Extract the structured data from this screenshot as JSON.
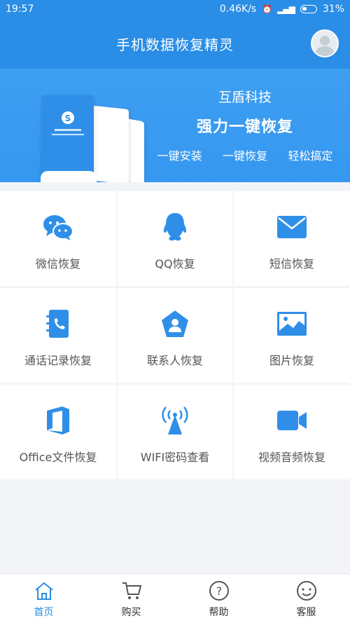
{
  "status": {
    "time": "19:57",
    "network_speed": "0.46K/s",
    "battery": "31%"
  },
  "header": {
    "title": "手机数据恢复精灵"
  },
  "banner": {
    "company": "互盾科技",
    "slogan": "强力一键恢复",
    "features": [
      "一键安装",
      "一键恢复",
      "轻松搞定"
    ]
  },
  "grid": {
    "items": [
      {
        "label": "微信恢复",
        "icon": "wechat-icon"
      },
      {
        "label": "QQ恢复",
        "icon": "qq-icon"
      },
      {
        "label": "短信恢复",
        "icon": "sms-icon"
      },
      {
        "label": "通话记录恢复",
        "icon": "call-log-icon"
      },
      {
        "label": "联系人恢复",
        "icon": "contacts-icon"
      },
      {
        "label": "图片恢复",
        "icon": "image-icon"
      },
      {
        "label": "Office文件恢复",
        "icon": "office-icon"
      },
      {
        "label": "WIFI密码查看",
        "icon": "wifi-icon"
      },
      {
        "label": "视频音频恢复",
        "icon": "video-icon"
      }
    ]
  },
  "tabbar": {
    "items": [
      {
        "label": "首页",
        "icon": "home-icon",
        "active": true
      },
      {
        "label": "购买",
        "icon": "cart-icon",
        "active": false
      },
      {
        "label": "帮助",
        "icon": "help-icon",
        "active": false
      },
      {
        "label": "客服",
        "icon": "customer-service-icon",
        "active": false
      }
    ]
  },
  "colors": {
    "primary": "#2a8de6",
    "icon_blue": "#2f8fe8",
    "tile_bg": "#ffffff",
    "page_bg": "#f2f4f7"
  }
}
